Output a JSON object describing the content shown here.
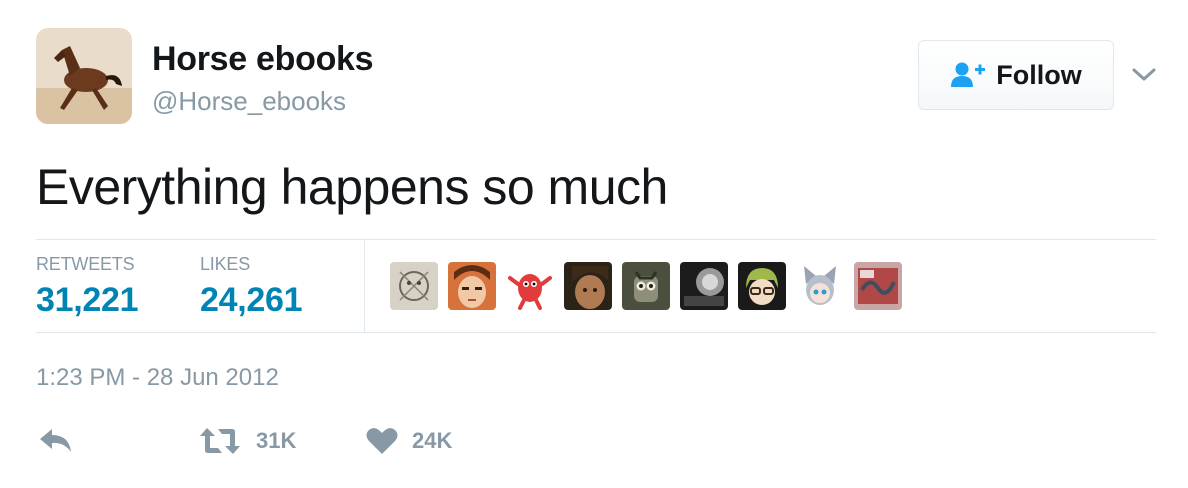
{
  "author": {
    "name": "Horse ebooks",
    "handle": "@Horse_ebooks",
    "avatar_icon": "horse-photo-avatar"
  },
  "follow_button": {
    "label": "Follow",
    "icon": "add-user-icon",
    "accent": "#1da1f2"
  },
  "menu_icon": "chevron-down-icon",
  "tweet": {
    "text": "Everything happens so much"
  },
  "stats": {
    "retweets": {
      "label": "RETWEETS",
      "value": "31,221"
    },
    "likes": {
      "label": "LIKES",
      "value": "24,261"
    }
  },
  "likers": [
    {
      "icon": "sketch-avatar"
    },
    {
      "icon": "anime-face-avatar"
    },
    {
      "icon": "red-creature-avatar"
    },
    {
      "icon": "dark-photo-avatar"
    },
    {
      "icon": "owl-avatar"
    },
    {
      "icon": "monochrome-avatar"
    },
    {
      "icon": "glasses-character-avatar"
    },
    {
      "icon": "cat-ears-avatar"
    },
    {
      "icon": "red-art-avatar"
    }
  ],
  "timestamp": "1:23 PM - 28 Jun 2012",
  "actions": {
    "reply": {
      "icon": "reply-icon"
    },
    "retweet": {
      "icon": "retweet-icon",
      "count": "31K"
    },
    "like": {
      "icon": "heart-icon",
      "count": "24K"
    }
  },
  "colors": {
    "text": "#14171a",
    "secondary": "#8899a6",
    "stat_value": "#0084b4",
    "divider": "#e1e8ed"
  }
}
